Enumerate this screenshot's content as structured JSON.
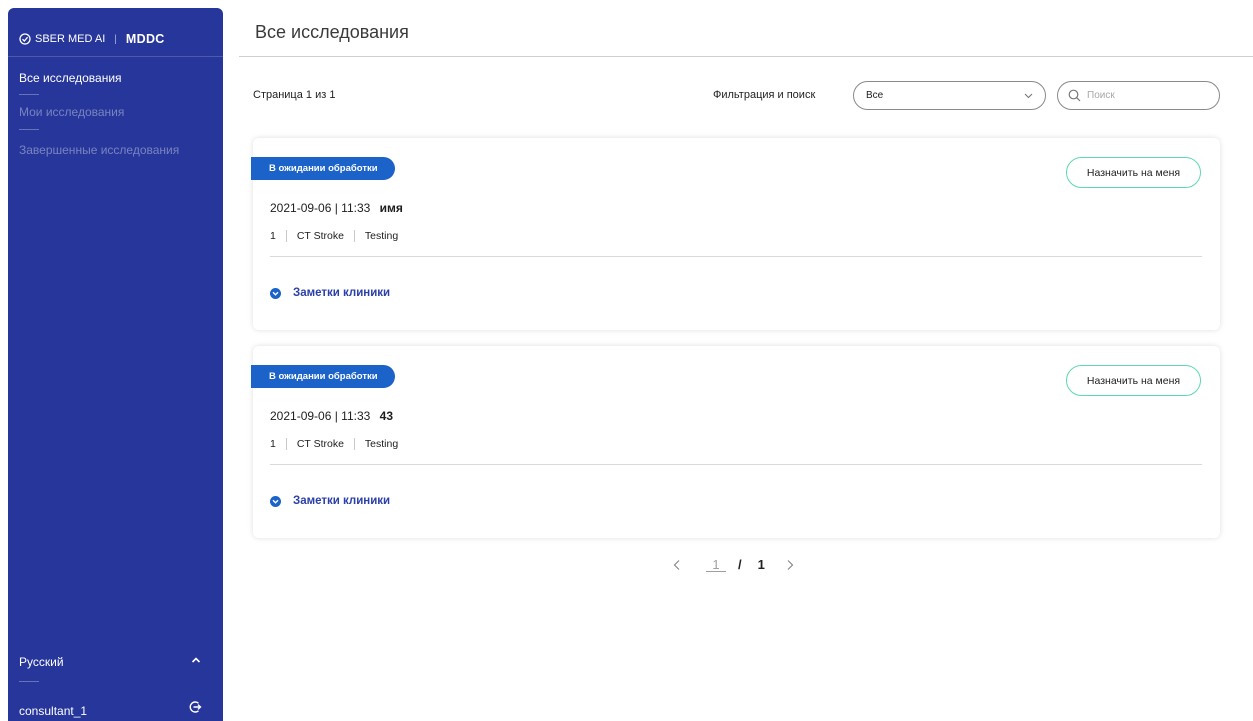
{
  "sidebar": {
    "brand": "SBER MED AI",
    "brand_divider": "|",
    "product": "MDDC",
    "items": [
      {
        "label": "Все исследования"
      },
      {
        "label": "Мои исследования"
      },
      {
        "label": "Завершенные исследования"
      }
    ],
    "language": "Русский",
    "user": "consultant_1"
  },
  "header": {
    "title": "Все исследования"
  },
  "toolbar": {
    "page_info": "Страница 1 из 1",
    "filter_label": "Фильтрация и поиск",
    "filter_value": "Все",
    "search_placeholder": "Поиск"
  },
  "studies": [
    {
      "status": "В ожидании обработки",
      "assign_label": "Назначить на меня",
      "datetime": "2021-09-06 | 11:33",
      "name": "имя",
      "id": "1",
      "type": "CT Stroke",
      "tag": "Testing",
      "notes_label": "Заметки клиники"
    },
    {
      "status": "В ожидании обработки",
      "assign_label": "Назначить на меня",
      "datetime": "2021-09-06 | 11:33",
      "name": "43",
      "id": "1",
      "type": "CT Stroke",
      "tag": "Testing",
      "notes_label": "Заметки клиники"
    }
  ],
  "pagination": {
    "current": "1",
    "separator": "/",
    "total": "1"
  },
  "colors": {
    "sidebar": "#26369a",
    "badge": "#1b63c8",
    "assign_border": "#5dd8b2",
    "notes": "#2a3fa8"
  }
}
